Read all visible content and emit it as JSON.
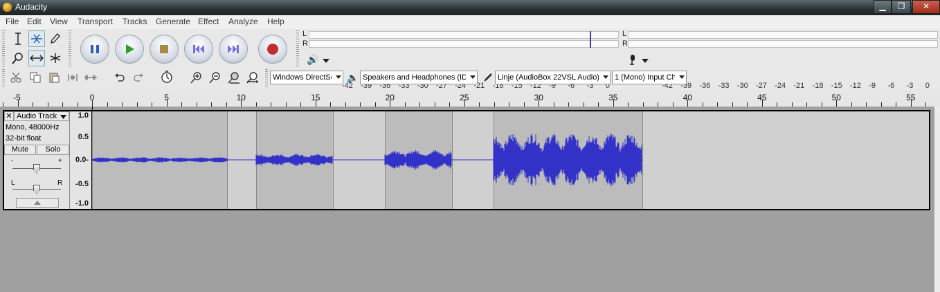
{
  "window": {
    "title": "Audacity",
    "min_glyph": "▁",
    "max_glyph": "❐",
    "close_glyph": "✕"
  },
  "menu": [
    "File",
    "Edit",
    "View",
    "Transport",
    "Tracks",
    "Generate",
    "Effect",
    "Analyze",
    "Help"
  ],
  "tools": {
    "row1": [
      "selection-tool",
      "envelope-tool",
      "draw-tool"
    ],
    "row2": [
      "zoom-tool",
      "timeshift-tool",
      "multi-tool"
    ]
  },
  "meters": {
    "playback": {
      "L": "L",
      "R": "R"
    },
    "record": {
      "L": "L",
      "R": "R"
    },
    "scale": [
      "-42",
      "-39",
      "-36",
      "-33",
      "-30",
      "-27",
      "-24",
      "-21",
      "-18",
      "-15",
      "-12",
      "-9",
      "-6",
      "-3",
      "0"
    ]
  },
  "device": {
    "host": "Windows DirectSc",
    "output": "Speakers and Headphones (ID",
    "input": "Linje (AudioBox 22VSL Audio)",
    "channels": "1 (Mono) Input Ch"
  },
  "ruler": {
    "labels": [
      "-5",
      "0",
      "5",
      "10",
      "15",
      "20",
      "25",
      "30",
      "35",
      "40",
      "45",
      "50",
      "55"
    ]
  },
  "track": {
    "name": "Audio Track",
    "rate": "Mono, 48000Hz",
    "format": "32-bit float",
    "mute": "Mute",
    "solo": "Solo",
    "gain_minus": "-",
    "gain_plus": "+",
    "pan_left": "L",
    "pan_right": "R",
    "scale": [
      "1.0",
      "0.5",
      "0.0-",
      "-0.5",
      "-1.0"
    ]
  },
  "colors": {
    "waveform": "#3232c8",
    "clip": "#bcbcbc",
    "gap": "#d0d0d0"
  }
}
